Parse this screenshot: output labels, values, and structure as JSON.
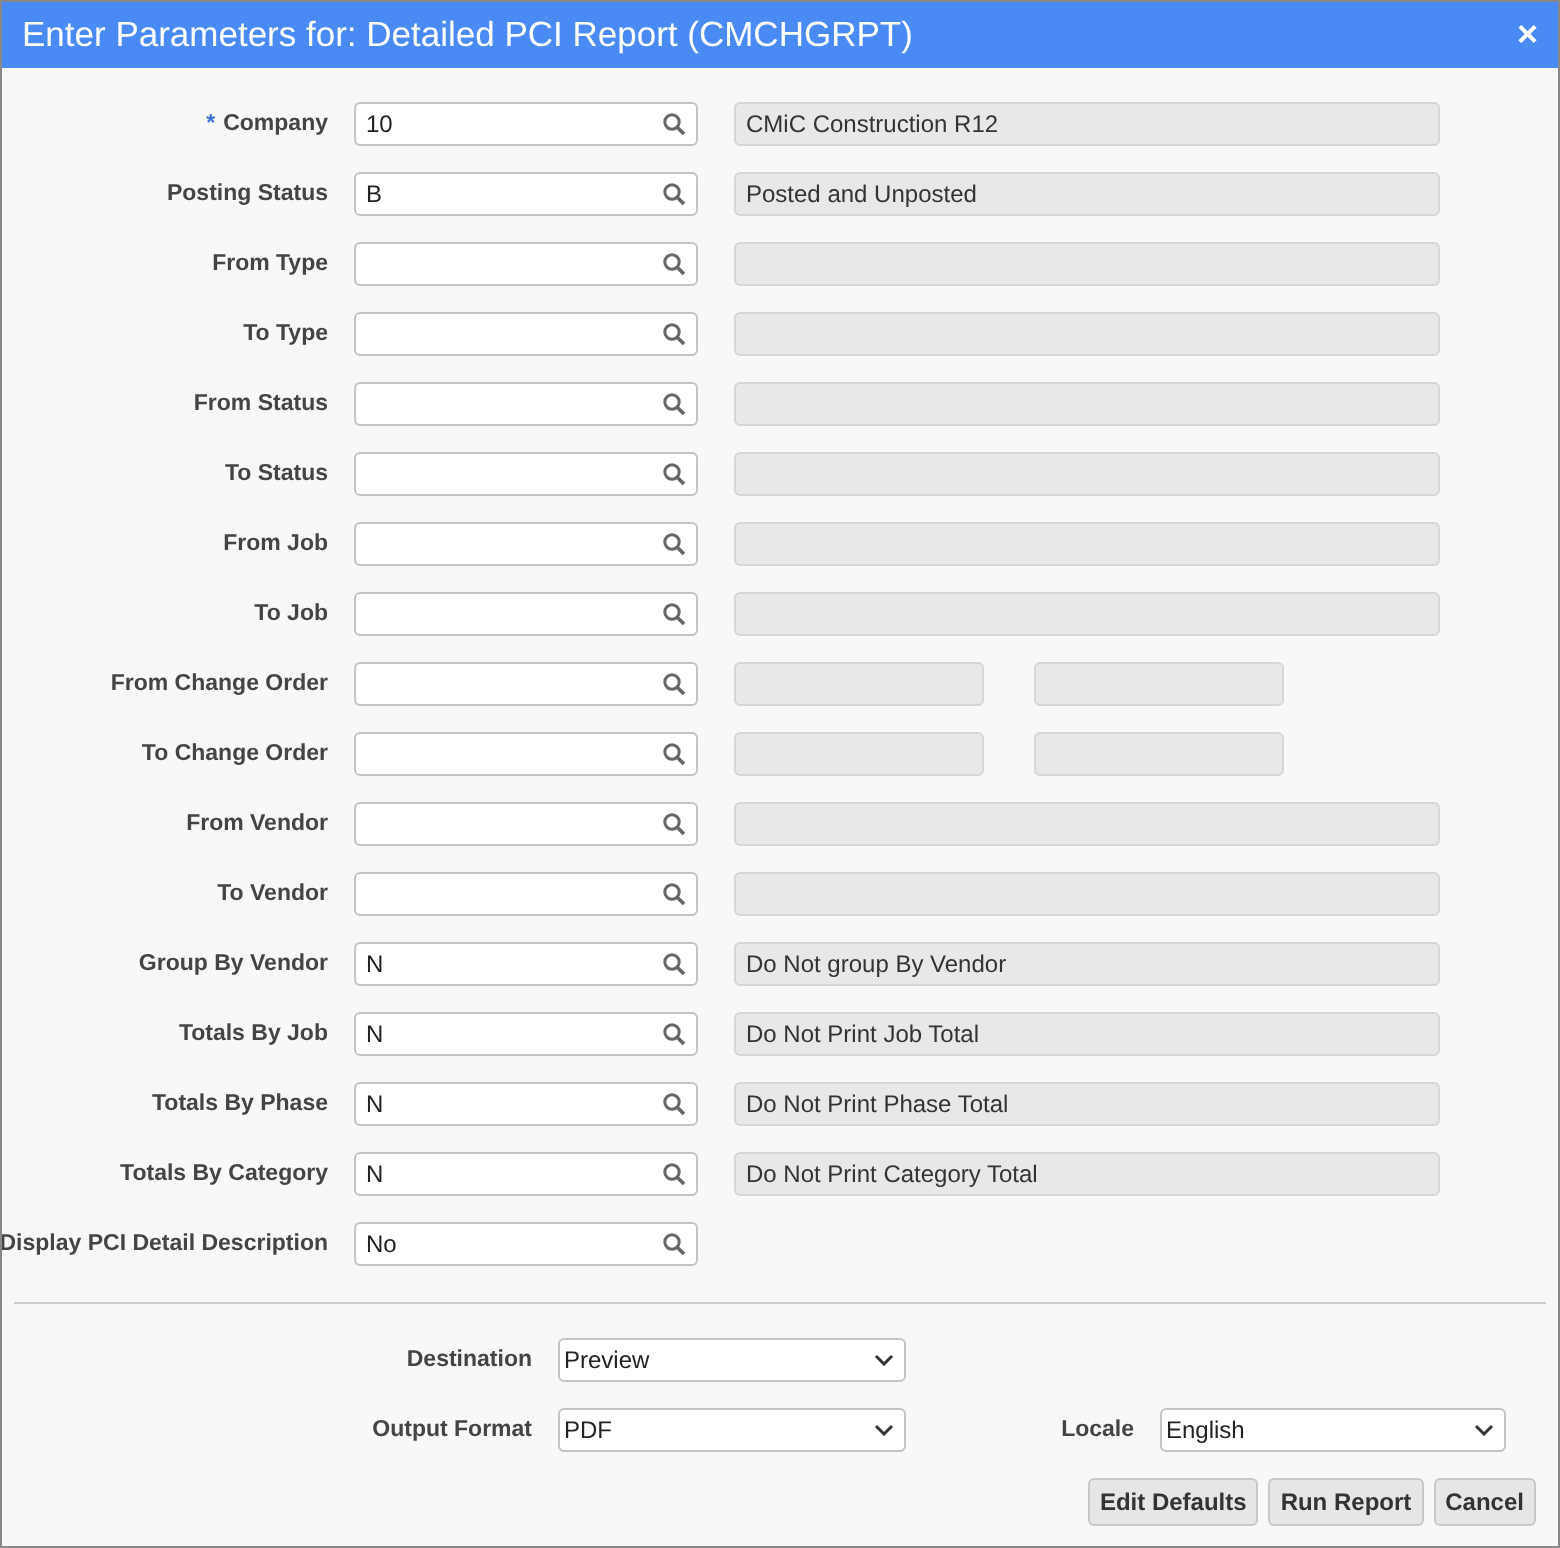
{
  "window": {
    "title": "Enter Parameters for: Detailed PCI Report (CMCHGRPT)",
    "close": "×"
  },
  "parameters": [
    {
      "label": "Company",
      "mark": "*",
      "value": "10",
      "kind": "desc",
      "description": "CMiC Construction R12"
    },
    {
      "label": "Posting Status",
      "value": "B",
      "kind": "desc",
      "description": "Posted and Unposted"
    },
    {
      "label": "From Type",
      "kind": "desc"
    },
    {
      "label": "To Type",
      "kind": "desc"
    },
    {
      "label": "From Status",
      "kind": "desc"
    },
    {
      "label": "To Status",
      "kind": "desc"
    },
    {
      "label": "From Job",
      "kind": "desc"
    },
    {
      "label": "To Job",
      "kind": "desc"
    },
    {
      "label": "From Change Order",
      "kind": "split"
    },
    {
      "label": "To Change Order",
      "kind": "split"
    },
    {
      "label": "From Vendor",
      "kind": "desc"
    },
    {
      "label": "To Vendor",
      "kind": "desc"
    },
    {
      "label": "Group By Vendor",
      "value": "N",
      "kind": "desc",
      "description": "Do Not group By Vendor"
    },
    {
      "label": "Totals By Job",
      "value": "N",
      "kind": "desc",
      "description": "Do Not Print Job Total"
    },
    {
      "label": "Totals By Phase",
      "value": "N",
      "kind": "desc",
      "description": "Do Not Print Phase Total"
    },
    {
      "label": "Totals By Category",
      "value": "N",
      "kind": "desc",
      "description": "Do Not Print Category Total"
    },
    {
      "label": "Display PCI Detail Description",
      "value": "No",
      "kind": "none"
    }
  ],
  "destination": {
    "label": "Destination",
    "value": "Preview"
  },
  "output_format": {
    "label": "Output Format",
    "value": "PDF"
  },
  "locale": {
    "label": "Locale",
    "value": "English"
  },
  "buttons": [
    "Edit Defaults",
    "Run Report",
    "Cancel"
  ]
}
